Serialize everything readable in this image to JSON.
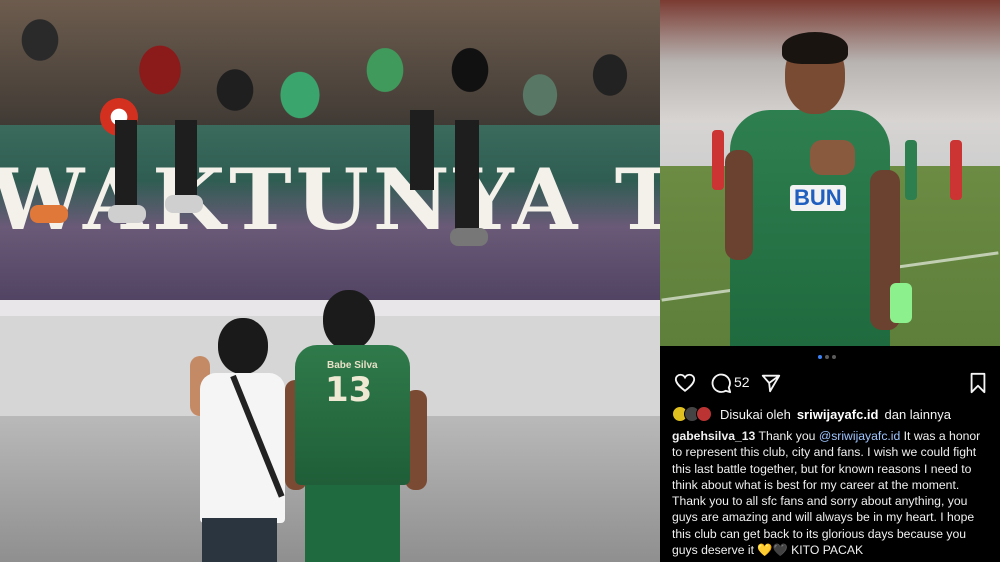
{
  "left_photo": {
    "banner_text": "WAKTUNYA TA",
    "player_jersey_name": "Babe Silva",
    "player_jersey_number": "13"
  },
  "right_photo": {
    "sponsor_text": "BUN"
  },
  "post": {
    "carousel_dots": 3,
    "carousel_active": 0,
    "comment_count": "52",
    "likes": {
      "prefix": "Disukai oleh",
      "user": "sriwijayafc.id",
      "suffix": "dan lainnya"
    },
    "caption": {
      "username": "gabehsilva_13",
      "text_before_mention": "Thank you",
      "mention": "@sriwijayafc.id",
      "text_after_mention": "It was a honor to represent this club, city and fans. I wish we could fight this last battle together, but for known reasons I need to think about what is best for my career at the moment. Thank you to all sfc fans and sorry about anything, you guys are amazing and will always be in my heart. I hope this club can get back to its glorious days because you guys deserve it 💛🖤 KITO PACAK"
    },
    "icons": [
      "heart-icon",
      "comment-icon",
      "share-icon",
      "bookmark-icon"
    ],
    "colors": {
      "background": "#000000",
      "mention": "#9ec5ff",
      "active_dot": "#3b82f6"
    }
  }
}
